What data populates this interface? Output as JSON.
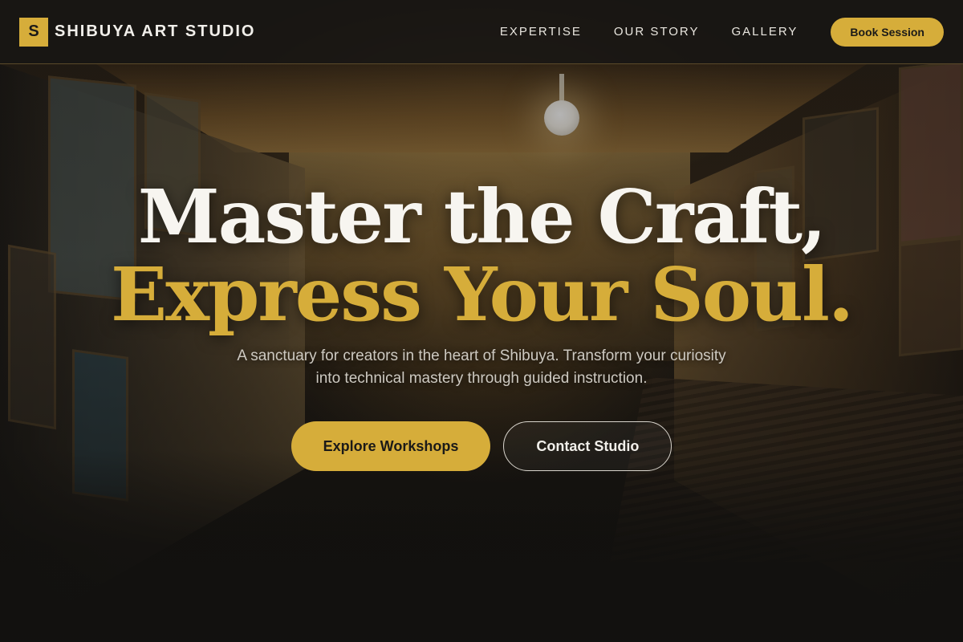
{
  "brand": {
    "mark": "S",
    "name": "SHIBUYA ART STUDIO"
  },
  "nav": {
    "items": [
      {
        "label": "EXPERTISE"
      },
      {
        "label": "OUR STORY"
      },
      {
        "label": "GALLERY"
      }
    ],
    "cta_label": "Book Session"
  },
  "hero": {
    "headline_line1": "Master the Craft,",
    "headline_line2": "Express Your Soul.",
    "subtitle": "A sanctuary for creators in the heart of Shibuya. Transform your curiosity into technical mastery through guided instruction.",
    "primary_cta": "Explore Workshops",
    "secondary_cta": "Contact Studio"
  },
  "theme": {
    "accent": "#d6ad3a",
    "header_bg": "#181614",
    "text_light": "#f7f5f0",
    "text_muted": "#cdc9c1"
  }
}
